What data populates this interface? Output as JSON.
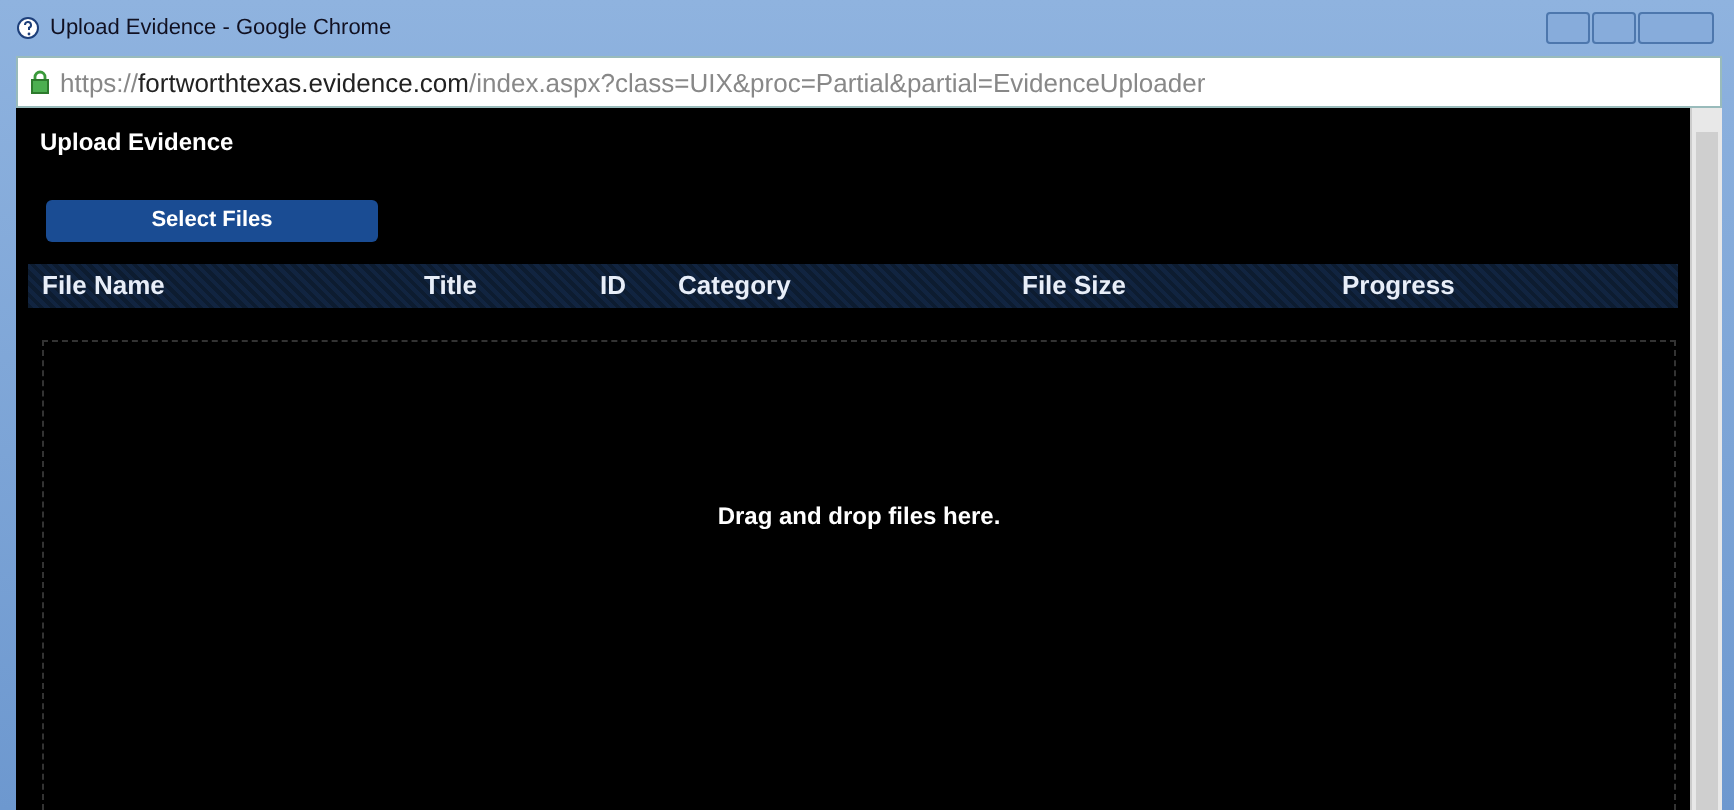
{
  "window": {
    "title": "Upload Evidence - Google Chrome"
  },
  "address_bar": {
    "secure": true,
    "scheme": "https://",
    "host": "fortworthtexas.evidence.com",
    "path": "/index.aspx?class=UIX&proc=Partial&partial=EvidenceUploader"
  },
  "page": {
    "heading": "Upload Evidence",
    "select_button": "Select Files",
    "table": {
      "columns": [
        "File Name",
        "Title",
        "ID",
        "Category",
        "File Size",
        "Progress"
      ]
    },
    "drop_zone": {
      "text": "Drag and drop files here."
    }
  }
}
